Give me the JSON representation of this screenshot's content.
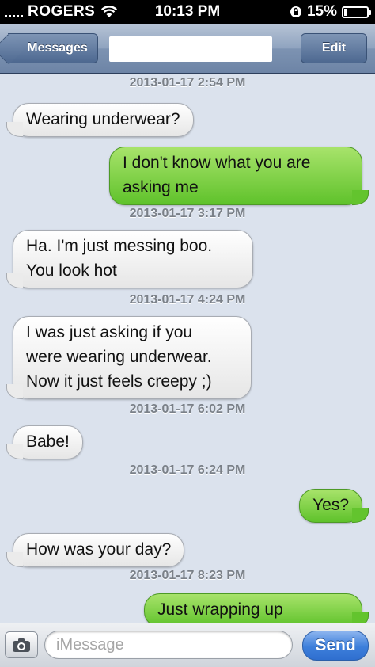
{
  "status_bar": {
    "carrier": "ROGERS",
    "time": "10:13 PM",
    "battery_percent": "15%",
    "battery_level": 0.15,
    "icons": [
      "signal-bars-icon",
      "wifi-icon",
      "rotation-lock-icon",
      "battery-icon"
    ]
  },
  "nav": {
    "back_label": "Messages",
    "edit_label": "Edit"
  },
  "thread": [
    {
      "kind": "timestamp",
      "text": "2013-01-17 2:54 PM"
    },
    {
      "kind": "incoming",
      "text": "Wearing underwear?"
    },
    {
      "kind": "outgoing",
      "text": "I don't know what you are\nasking me"
    },
    {
      "kind": "timestamp",
      "text": "2013-01-17 3:17 PM"
    },
    {
      "kind": "incoming",
      "text": "Ha. I'm just messing boo.\nYou look hot"
    },
    {
      "kind": "timestamp",
      "text": "2013-01-17 4:24 PM"
    },
    {
      "kind": "incoming",
      "text": "I was just asking if you\nwere wearing underwear.\nNow it just feels creepy ;)"
    },
    {
      "kind": "timestamp",
      "text": "2013-01-17 6:02 PM"
    },
    {
      "kind": "incoming",
      "text": "Babe!"
    },
    {
      "kind": "timestamp",
      "text": "2013-01-17 6:24 PM"
    },
    {
      "kind": "outgoing",
      "text": "Yes?"
    },
    {
      "kind": "incoming",
      "text": "How was your day?"
    },
    {
      "kind": "timestamp",
      "text": "2013-01-17 8:23 PM"
    },
    {
      "kind": "outgoing",
      "text": "Just wrapping up"
    }
  ],
  "compose": {
    "placeholder": "iMessage",
    "send_label": "Send"
  },
  "colors": {
    "outgoing_bubble": "#7bd13f",
    "incoming_bubble": "#f2f2f2",
    "background": "#dbe2ed",
    "send_button": "#3d7fdb"
  }
}
